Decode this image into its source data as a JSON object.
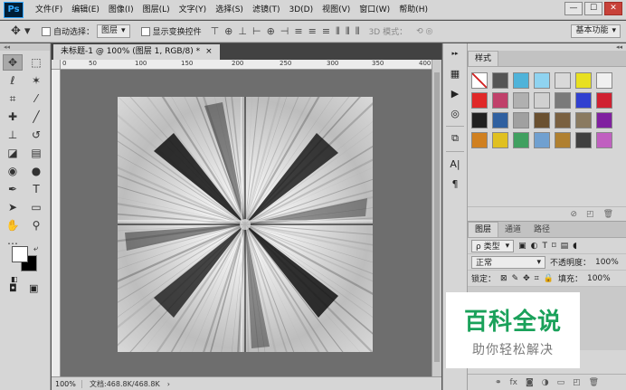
{
  "app": {
    "logo": "Ps"
  },
  "menu": [
    "文件(F)",
    "编辑(E)",
    "图像(I)",
    "图层(L)",
    "文字(Y)",
    "选择(S)",
    "滤镜(T)",
    "3D(D)",
    "视图(V)",
    "窗口(W)",
    "帮助(H)"
  ],
  "window_controls": {
    "minimize": "—",
    "maximize": "☐",
    "close": "✕"
  },
  "options": {
    "tool_icon": "move-tool",
    "auto_select_label": "自动选择：",
    "auto_select_value": "图层",
    "show_transform_label": "显示变换控件",
    "mode_3d_label": "3D 模式：",
    "workspace_value": "基本功能"
  },
  "document": {
    "tab_title": "未标题-1 @ 100% (图层 1, RGB/8) *",
    "tab_close": "×",
    "ruler_h_labels": [
      "0",
      "50",
      "100",
      "150",
      "200",
      "250",
      "300",
      "350",
      "400"
    ],
    "zoom": "100%",
    "doc_size": "文档:468.8K/468.8K"
  },
  "styles_panel": {
    "tab_label": "样式",
    "swatch_colors": [
      "#ffffff",
      "#555555",
      "#4fb3d9",
      "#8fd3f0",
      "#d9d9d9",
      "#e8e020",
      "#f0f0f0",
      "#e02828",
      "#c0406a",
      "#b0b0b0",
      "#d0d0d0",
      "#7a7a7a",
      "#3040d0",
      "#d02030",
      "#202020",
      "#3060a0",
      "#a0a0a0",
      "#6a5030",
      "#7a6040",
      "#8a7a60",
      "#8020a0",
      "#d08020",
      "#e0c020",
      "#40a060",
      "#70a0d0",
      "#b08030",
      "#404040",
      "#c060c0"
    ]
  },
  "layers_panel": {
    "tabs": [
      "图层",
      "通道",
      "路径"
    ],
    "filter_label": "ρ 类型",
    "blend_mode": "正常",
    "opacity_label": "不透明度：",
    "opacity_value": "100%",
    "lock_label": "锁定：",
    "fill_label": "填充：",
    "fill_value": "100%",
    "footer_icons": [
      "link-icon",
      "fx-icon",
      "mask-icon",
      "adjustment-icon",
      "folder-icon",
      "new-layer-icon",
      "trash-icon"
    ]
  },
  "watermark": {
    "title": "百科全说",
    "subtitle": "助你轻松解决"
  }
}
